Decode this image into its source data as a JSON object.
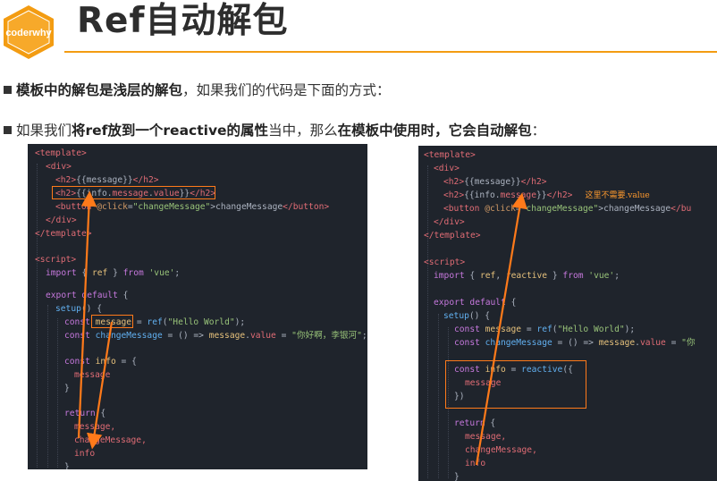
{
  "logo": {
    "text": "coderwhy"
  },
  "header": {
    "title": "Ref自动解包"
  },
  "bullets": [
    {
      "bold": "模板中的解包是浅层的解包",
      "rest": "，如果我们的代码是下面的方式："
    },
    {
      "pre": "如果我们",
      "bold1": "将ref放到一个reactive的属性",
      "mid": "当中，那么",
      "bold2": "在模板中使用时，它会自动解包",
      "post": "："
    }
  ],
  "left_code": {
    "l1": "<template>",
    "l2": "<div>",
    "l3a": "<h2>",
    "l3b": "{{message}}",
    "l3c": "</h2>",
    "l4a": "<h2>",
    "l4b": "{{info.",
    "l4c": "message",
    "l4d": ".",
    "l4e": "value",
    "l4f": "}}",
    "l4g": "</h2>",
    "l5a": "<button ",
    "l5b": "@click",
    "l5c": "=",
    "l5d": "\"changeMessage\"",
    "l5e": ">changeMessage",
    "l5f": "</button>",
    "l6": "</div>",
    "l7": "</template>",
    "l8": "<script>",
    "l9a": "import",
    "l9b": " { ",
    "l9c": "ref",
    "l9d": " } ",
    "l9e": "from",
    "l9f": " 'vue'",
    "l9g": ";",
    "l10a": "export default",
    "l10b": " {",
    "l11a": "setup",
    "l11b": "() {",
    "l12a": "const ",
    "l12b": "message",
    "l12c": " = ",
    "l12d": "ref",
    "l12e": "(",
    "l12f": "\"Hello World\"",
    "l12g": ");",
    "l13a": "const ",
    "l13b": "changeMessage",
    "l13c": " = () => ",
    "l13d": "message",
    "l13e": ".",
    "l13f": "value",
    "l13g": " = ",
    "l13h": "\"你好啊，李银河\"",
    "l13i": ";",
    "l14a": "const ",
    "l14b": "info",
    "l14c": " = {",
    "l15": "message",
    "l16": "}",
    "l17a": "return",
    "l17b": " {",
    "l18": "message,",
    "l19": "changeMessage,",
    "l20": "info",
    "l21": "}"
  },
  "right_code": {
    "r1": "<template>",
    "r2": "<div>",
    "r3a": "<h2>",
    "r3b": "{{message}}",
    "r3c": "</h2>",
    "r4a": "<h2>",
    "r4b": "{{info.",
    "r4c": "message",
    "r4d": "}}",
    "r4e": "</h2>",
    "r4note": "这里不需要.value",
    "r5a": "<button ",
    "r5b": "@click",
    "r5c": "=",
    "r5d": "\"changeMessage\"",
    "r5e": ">changeMessage",
    "r5f": "</bu",
    "r6": "</div>",
    "r7": "</template>",
    "r8": "<script>",
    "r9a": "import",
    "r9b": " { ",
    "r9c": "ref",
    "r9d": ", ",
    "r9e": "reactive",
    "r9f": " } ",
    "r9g": "from",
    "r9h": " 'vue'",
    "r9i": ";",
    "r10a": "export default",
    "r10b": " {",
    "r11a": "setup",
    "r11b": "() {",
    "r12a": "const ",
    "r12b": "message",
    "r12c": " = ",
    "r12d": "ref",
    "r12e": "(",
    "r12f": "\"Hello World\"",
    "r12g": ");",
    "r13a": "const ",
    "r13b": "changeMessage",
    "r13c": " = () => ",
    "r13d": "message",
    "r13e": ".",
    "r13f": "value",
    "r13g": " = ",
    "r13h": "\"你",
    "r14a": "const ",
    "r14b": "info",
    "r14c": " = ",
    "r14d": "reactive",
    "r14e": "({",
    "r15": "message",
    "r16": "})",
    "r17a": "return",
    "r17b": " {",
    "r18": "message,",
    "r19": "changeMessage,",
    "r20": "info",
    "r21": "}"
  },
  "colors": {
    "accent": "#f39c12",
    "highlight_box": "#ff7a1a",
    "code_bg": "#1f242c"
  }
}
